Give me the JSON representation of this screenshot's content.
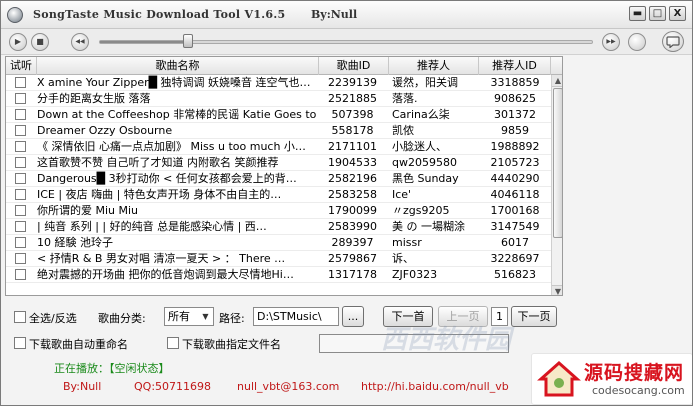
{
  "app": {
    "title": "SongTaste Music Download Tool  V1.6.5",
    "author_tag": "By:Null"
  },
  "window_controls": {
    "minimize": "▬",
    "maximize": "□",
    "close": "X"
  },
  "player": {
    "progress": 0.18,
    "buttons": {
      "play": "▶",
      "stop": "■",
      "prev": "◀◀",
      "next": "▶▶"
    }
  },
  "table": {
    "headers": [
      "试听",
      "歌曲名称",
      "歌曲ID",
      "推荐人",
      "推荐人ID"
    ],
    "rows": [
      {
        "name": "X amine Your Zipper█  独特调调 妖娆嗓音 连空气也…",
        "id": "2239139",
        "recommender": "谖然，阳关调",
        "rid": "3318859"
      },
      {
        "name": "分手的距离女生版 落落",
        "id": "2521885",
        "recommender": "落落.",
        "rid": "908625"
      },
      {
        "name": "Down at the Coffeeshop 非常棒的民谣 Katie Goes to …",
        "id": "507398",
        "recommender": "Carina么柒",
        "rid": "301372"
      },
      {
        "name": "Dreamer Ozzy Osbourne",
        "id": "558178",
        "recommender": "凯侬",
        "rid": "9859"
      },
      {
        "name": "《 深情依旧 心痛一点点加剧》 Miss u too much 小…",
        "id": "2171101",
        "recommender": "小腍迷人、",
        "rid": "1988892"
      },
      {
        "name": "这首歌赞不赞 自己听了才知道 内附歌名 笑颜推荐",
        "id": "1904533",
        "recommender": "qw2059580",
        "rid": "2105723"
      },
      {
        "name": "Dangerous█  3秒打动你 < 任何女孩都会爱上的背…",
        "id": "2582196",
        "recommender": "黑色 Sunday",
        "rid": "4440290"
      },
      {
        "name": "ICE | 夜店 嗨曲 | 特色女声开场 身体不由自主的…",
        "id": "2583258",
        "recommender": "Ice'",
        "rid": "4046118"
      },
      {
        "name": "你所谓的爱 Miu Miu",
        "id": "1790099",
        "recommender": "〃zgs9205",
        "rid": "1700168"
      },
      {
        "name": "| 纯音 系列 | | 好的纯音 总是能感染心情 | 西…",
        "id": "2583990",
        "recommender": "美 の 一場糊涂",
        "rid": "3147549"
      },
      {
        "name": "10 経験 池玲子",
        "id": "289397",
        "recommender": "missr",
        "rid": "6017"
      },
      {
        "name": "  < 抒情R & B 男女对唱 清凉一夏天 > ： There …",
        "id": "2579867",
        "recommender": "诉、",
        "rid": "3228697"
      },
      {
        "name": "绝对震撼的开场曲 把你的低音炮调到最大尽情地Hi…",
        "id": "1317178",
        "recommender": "ZJF0323",
        "rid": "516823"
      }
    ]
  },
  "controls": {
    "select_all_label": "全选/反选",
    "category_label": "歌曲分类:",
    "category_value": "所有",
    "path_label": "路径:",
    "path_value": "D:\\STMusic\\",
    "browse_label": "...",
    "first_page": "下一首",
    "prev_page": "上一页",
    "page_number": "1",
    "next_page": "下一页",
    "auto_rename_label": "下载歌曲自动重命名",
    "custom_name_label": "下载歌曲指定文件名"
  },
  "status": "正在播放：【空闲状态】",
  "footer": {
    "author": "By:Null",
    "qq": "QQ:50711698",
    "email": "null_vbt@163.com",
    "url": "http://hi.baidu.com/null_vb"
  },
  "watermark": {
    "cn": "源码搜藏网",
    "en": "codesocang.com",
    "faint": "西西软件园"
  },
  "colors": {
    "status_green": "#1a8a1a",
    "footer_red": "#c01818",
    "watermark_red": "#d8141f"
  }
}
